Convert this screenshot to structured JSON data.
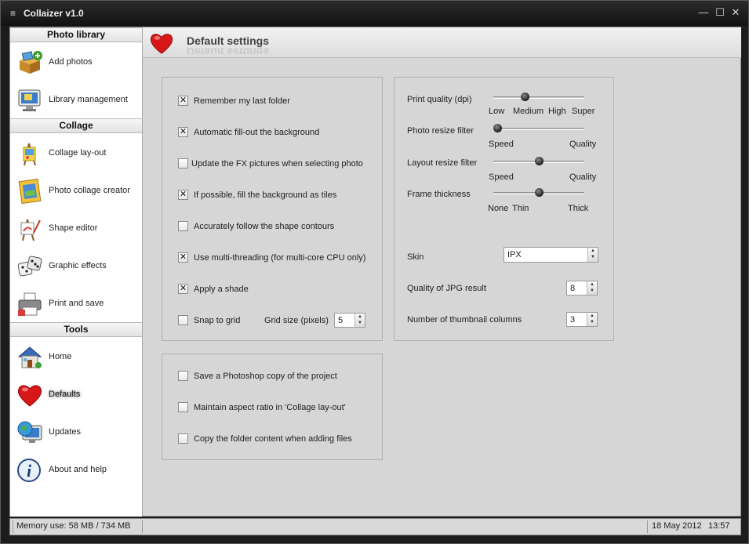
{
  "window": {
    "title": "Collaizer v1.0",
    "menu_glyph": "≡",
    "minimize": "—",
    "maximize": "☐",
    "close": "✕"
  },
  "sidebar": {
    "sections": [
      {
        "title": "Photo library",
        "items": [
          {
            "label": "Add photos",
            "icon": "add-photos-box-icon"
          },
          {
            "label": "Library management",
            "icon": "monitor-library-icon"
          }
        ]
      },
      {
        "title": "Collage",
        "items": [
          {
            "label": "Collage lay-out",
            "icon": "easel-icon"
          },
          {
            "label": "Photo collage creator",
            "icon": "photo-frame-icon"
          },
          {
            "label": "Shape editor",
            "icon": "paint-easel-icon"
          },
          {
            "label": "Graphic effects",
            "icon": "dice-icon"
          },
          {
            "label": "Print and save",
            "icon": "printer-icon"
          }
        ]
      },
      {
        "title": "Tools",
        "items": [
          {
            "label": "Home",
            "icon": "house-icon"
          },
          {
            "label": "Defaults",
            "icon": "heart-icon",
            "active": true
          },
          {
            "label": "Updates",
            "icon": "globe-monitor-icon"
          },
          {
            "label": "About and help",
            "icon": "info-icon"
          }
        ]
      }
    ]
  },
  "main": {
    "title": "Default settings",
    "options": [
      {
        "label": "Remember my last folder",
        "checked": true
      },
      {
        "label": "Automatic fill-out the background",
        "checked": true
      },
      {
        "label": "Update the FX pictures when selecting photo",
        "checked": false
      },
      {
        "label": "If possible, fill the background as tiles",
        "checked": true
      },
      {
        "label": "Accurately follow the shape contours",
        "checked": false
      },
      {
        "label": "Use multi-threading (for multi-core CPU only)",
        "checked": true
      },
      {
        "label": "Apply a shade",
        "checked": true
      },
      {
        "label": "Snap to grid",
        "checked": false
      }
    ],
    "grid_size": {
      "label": "Grid size (pixels)",
      "value": "5"
    },
    "options2": [
      {
        "label": "Save a Photoshop copy of the project",
        "checked": false
      },
      {
        "label": "Maintain aspect ratio in 'Collage lay-out'",
        "checked": false
      },
      {
        "label": "Copy the folder content when adding files",
        "checked": false
      }
    ],
    "sliders": [
      {
        "label": "Print quality (dpi)",
        "ticks": [
          "Low",
          "Medium",
          "High",
          "Super"
        ],
        "value": 0.33
      },
      {
        "label": "Photo resize filter",
        "ticks": [
          "Speed",
          "Quality"
        ],
        "value": 0.0
      },
      {
        "label": "Layout resize filter",
        "ticks": [
          "Speed",
          "Quality"
        ],
        "value": 0.5
      },
      {
        "label": "Frame thickness",
        "ticks": [
          "None",
          "Thin",
          "Thick"
        ],
        "value": 0.5
      }
    ],
    "skin": {
      "label": "Skin",
      "value": "IPX"
    },
    "jpg_quality": {
      "label": "Quality of JPG result",
      "value": "8"
    },
    "thumb_columns": {
      "label": "Number of thumbnail columns",
      "value": "3"
    }
  },
  "status": {
    "memory": "Memory use: 58 MB / 734 MB",
    "date": "18 May 2012",
    "time": "13:57"
  }
}
